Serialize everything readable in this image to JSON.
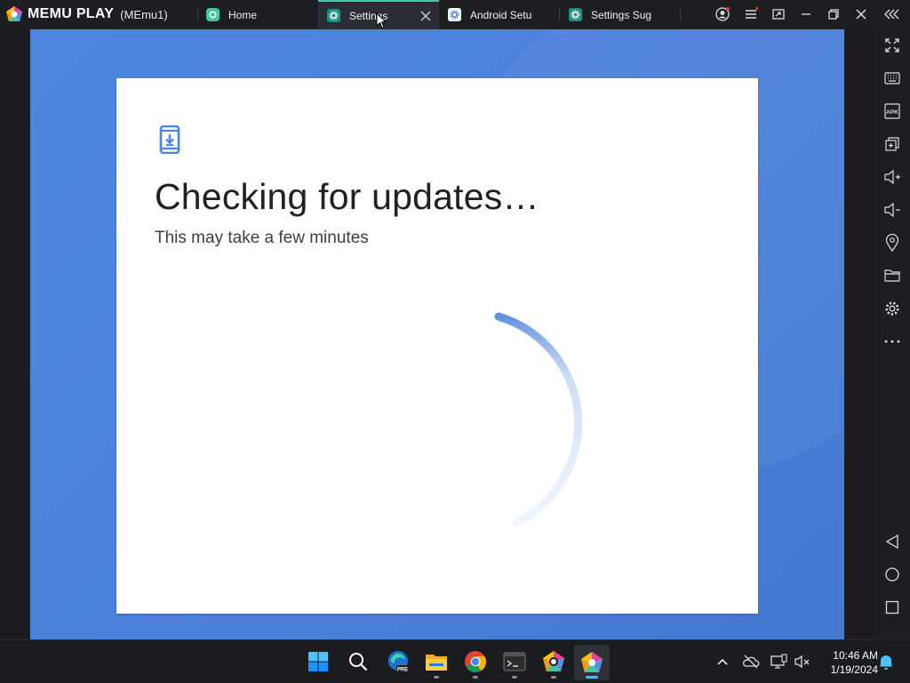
{
  "titlebar": {
    "brand": "MEMU PLAY",
    "instance": "(MEmu1)",
    "tabs": [
      {
        "label": "Home",
        "icon": "home-app-icon",
        "active": false
      },
      {
        "label": "Settings",
        "icon": "settings-gear-icon",
        "active": true
      },
      {
        "label": "Android Setu",
        "icon": "settings-gear-icon",
        "active": false
      },
      {
        "label": "Settings Sug",
        "icon": "settings-gear-icon",
        "active": false
      }
    ]
  },
  "content": {
    "icon": "phone-download-icon",
    "title": "Checking for updates…",
    "subtitle": "This may take a few minutes",
    "spinner": "loading-spinner"
  },
  "sidebar": {
    "buttons": [
      "fullscreen-icon",
      "keyboard-icon",
      "apk-icon",
      "multi-window-icon",
      "volume-up-icon",
      "volume-down-icon",
      "location-icon",
      "folder-icon",
      "settings-icon",
      "more-icon",
      "back-icon",
      "home-icon",
      "recents-icon"
    ],
    "apk_text": "APK"
  },
  "taskbar": {
    "apps": [
      "windows-start-icon",
      "search-icon",
      "edge-pre-icon",
      "file-explorer-icon",
      "chrome-icon",
      "terminal-icon",
      "memu-multi-icon",
      "memu-icon"
    ],
    "edge_badge": "PRE",
    "time": "10:46 AM",
    "date": "1/19/2024"
  },
  "colors": {
    "accent": "#3ec6a8",
    "screen_bg": "#4a80d9",
    "spinner": "#4f86dd"
  }
}
